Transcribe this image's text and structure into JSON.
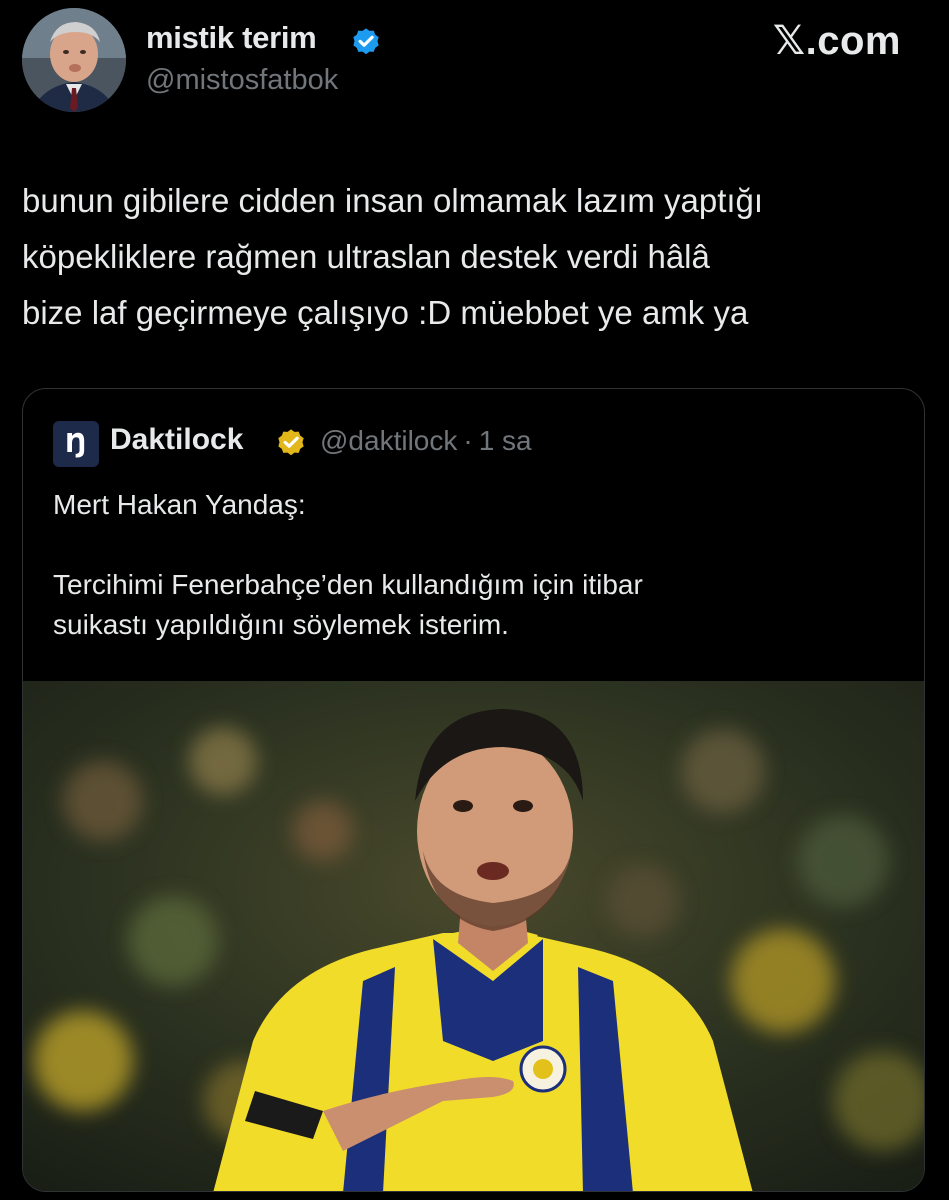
{
  "author": {
    "name": "mistik terim",
    "handle": "@mistosfatbok",
    "verified_color": "#1d9bf0",
    "avatar_icon": "profile-photo"
  },
  "site": {
    "label": "𝕏.com"
  },
  "tweet": {
    "text": "bunun gibilere cidden insan olmamak lazım yaptığı\nköpekliklere rağmen ultraslan destek verdi hâlâ\nbize laf geçirmeye çalışıyo :D müebbet ye amk ya"
  },
  "quote": {
    "avatar_glyph": "Ŋ",
    "name": "Daktilock",
    "handle": "@daktilock",
    "separator": "·",
    "time": "1 sa",
    "verified_color": "#e2b719",
    "text": "Mert Hakan Yandaş:\n\nTercihimi Fenerbahçe’den kullandığım için itibar\nsuikastı yapıldığını söylemek isterim.",
    "photo": {
      "icon": "football-player-photo",
      "jersey_colors": [
        "#f2dc2a",
        "#1c2f7a"
      ]
    }
  },
  "colors": {
    "background": "#000000",
    "text_primary": "#e7e9ea",
    "text_secondary": "#71767b",
    "border": "#2f3336"
  }
}
